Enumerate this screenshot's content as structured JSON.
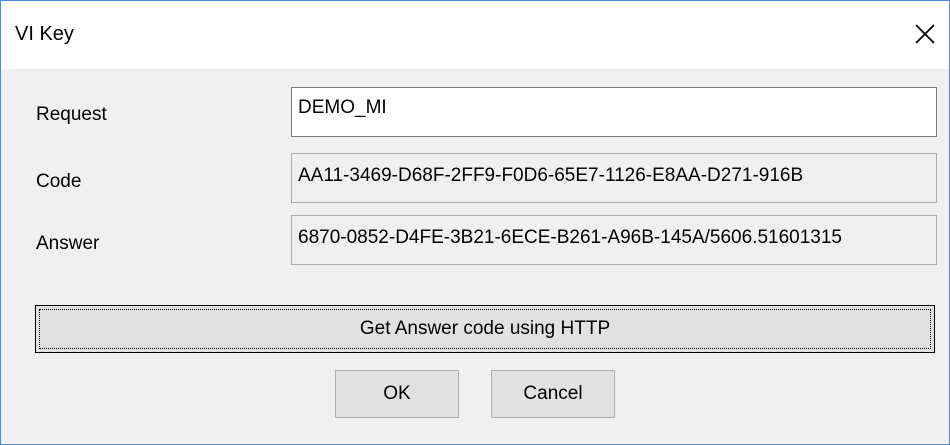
{
  "window": {
    "title": "VI Key",
    "close_icon": "close-icon"
  },
  "form": {
    "request_label": "Request",
    "request_value": "DEMO_MI",
    "code_label": "Code",
    "code_value": "AA11-3469-D68F-2FF9-F0D6-65E7-1126-E8AA-D271-916B",
    "answer_label": "Answer",
    "answer_value": "6870-0852-D4FE-3B21-6ECE-B261-A96B-145A/5606.51601315"
  },
  "buttons": {
    "http_label": "Get Answer code using HTTP",
    "ok_label": "OK",
    "cancel_label": "Cancel"
  },
  "colors": {
    "window_border": "#4a90d9",
    "dialog_background": "#f0f0f0",
    "button_face": "#e1e1e1"
  }
}
